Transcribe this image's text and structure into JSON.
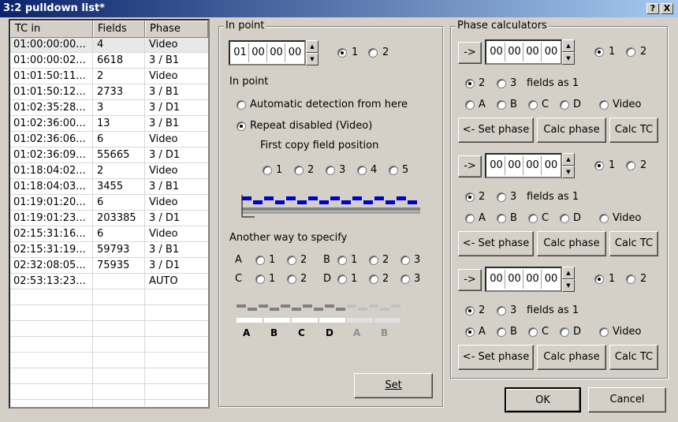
{
  "window": {
    "title": "3:2 pulldown list*",
    "help": "?",
    "close": "X"
  },
  "list": {
    "headers": [
      "TC in",
      "Fields",
      "Phase"
    ],
    "rows": [
      [
        "01:00:00:00...",
        "4",
        "Video"
      ],
      [
        "01:00:00:02...",
        "6618",
        "3 / B1"
      ],
      [
        "01:01:50:11...",
        "2",
        "Video"
      ],
      [
        "01:01:50:12...",
        "2733",
        "3 / B1"
      ],
      [
        "01:02:35:28...",
        "3",
        "3 / D1"
      ],
      [
        "01:02:36:00...",
        "13",
        "3 / B1"
      ],
      [
        "01:02:36:06...",
        "6",
        "Video"
      ],
      [
        "01:02:36:09...",
        "55665",
        "3 / D1"
      ],
      [
        "01:18:04:02...",
        "2",
        "Video"
      ],
      [
        "01:18:04:03...",
        "3455",
        "3 / B1"
      ],
      [
        "01:19:01:20...",
        "6",
        "Video"
      ],
      [
        "01:19:01:23...",
        "203385",
        "3 / D1"
      ],
      [
        "02:15:31:16...",
        "6",
        "Video"
      ],
      [
        "02:15:31:19...",
        "59793",
        "3 / B1"
      ],
      [
        "02:32:08:05...",
        "75935",
        "3 / D1"
      ],
      [
        "02:53:13:23...",
        "",
        "AUTO"
      ]
    ]
  },
  "inpoint": {
    "group_label": "In point",
    "tc": [
      "01",
      "00",
      "00",
      "00"
    ],
    "opt1": "1",
    "opt2": "2",
    "section": "In point",
    "auto": "Automatic detection from here",
    "repeat": "Repeat disabled (Video)",
    "first_copy": "First copy field position",
    "positions": [
      "1",
      "2",
      "3",
      "4",
      "5"
    ],
    "another": "Another way to specify",
    "abcd": [
      {
        "letter": "A",
        "o1": "1",
        "o2": "2"
      },
      {
        "letter": "B",
        "o1": "1",
        "o2": "2",
        "o3": "3"
      },
      {
        "letter": "C",
        "o1": "1",
        "o2": "2"
      },
      {
        "letter": "D",
        "o1": "1",
        "o2": "2",
        "o3": "3"
      }
    ],
    "bar_labels": [
      "A",
      "B",
      "C",
      "D",
      "A",
      "B"
    ],
    "set": "Set"
  },
  "phase": {
    "group_label": "Phase calculators",
    "arrow": "->",
    "opt1": "1",
    "opt2": "2",
    "f2": "2",
    "f3": "3",
    "fields_as": "fields as 1",
    "letters": [
      "A",
      "B",
      "C",
      "D"
    ],
    "video": "Video",
    "set_phase": "<- Set phase",
    "calc_phase": "Calc phase",
    "calc_tc": "Calc TC",
    "tc": [
      "00",
      "00",
      "00",
      "00"
    ]
  },
  "footer": {
    "ok": "OK",
    "cancel": "Cancel"
  }
}
